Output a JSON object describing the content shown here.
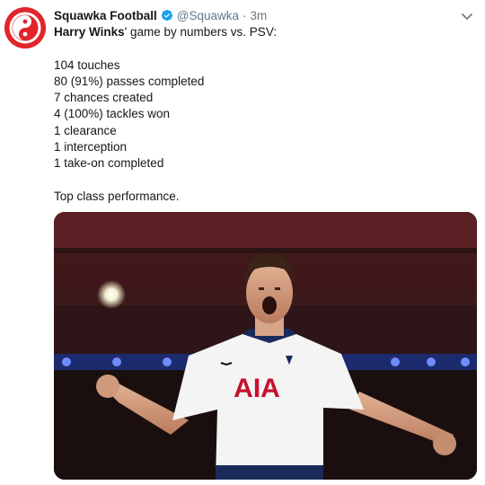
{
  "tweet": {
    "author_name": "Squawka Football",
    "handle": "@Squawka",
    "separator": "·",
    "time": "3m",
    "intro_player": "Harry Winks",
    "intro_rest": "' game by numbers vs. PSV:",
    "stats": [
      "104 touches",
      "80 (91%) passes completed",
      "7 chances created",
      "4 (100%) tackles won",
      "1 clearance",
      "1 interception",
      "1 take-on completed"
    ],
    "closing": "Top class performance.",
    "shirt_sponsor": "AIA"
  },
  "icons": {
    "avatar": "squawka-logo-icon",
    "verified": "verified-badge-icon",
    "caret": "chevron-down-icon"
  },
  "colors": {
    "brand_red": "#e2242b",
    "verified_blue": "#1da1f2",
    "muted_text": "#657786",
    "sponsor_red": "#c8102e"
  }
}
